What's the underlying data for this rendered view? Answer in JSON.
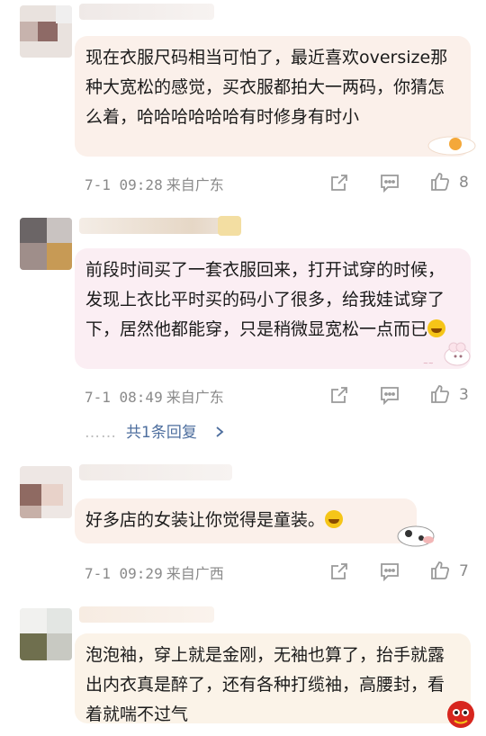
{
  "comments": [
    {
      "text": "现在衣服尺码相当可怕了，最近喜欢oversize那种大宽松的感觉，买衣服都拍大一两码，你猜怎么着，哈哈哈哈哈哈有时修身有时小",
      "time": "7-1 09:28",
      "location": "来自广东",
      "likes": "8",
      "bubble_color": "#fbf0ea"
    },
    {
      "text": "前段时间买了一套衣服回来，打开试穿的时候，发现上衣比平时买的码小了很多，给我娃试穿了下，居然他都能穿，只是稍微显宽松一点而已",
      "emoji": "laugh-cry-emoji",
      "time": "7-1 08:49",
      "location": "来自广东",
      "likes": "3",
      "replies_label": "共1条回复",
      "replies_dots": "……",
      "bubble_color": "#fbeef3"
    },
    {
      "text": "好多店的女装让你觉得是童装。",
      "emoji": "laugh-cry-emoji",
      "time": "7-1 09:29",
      "location": "来自广西",
      "likes": "7",
      "bubble_color": "#fbf0ea"
    },
    {
      "text": "泡泡袖，穿上就是金刚，无袖也算了，抬手就露出内衣真是醉了，还有各种打缆袖，高腰封，看着就喘不过气",
      "time": "",
      "location": "",
      "likes": "",
      "bubble_color": "#fbf3e8"
    }
  ],
  "icons": {
    "share": "share-icon",
    "comment": "comment-icon",
    "like": "thumbs-up-icon",
    "chevron": "chevron-right-icon"
  }
}
